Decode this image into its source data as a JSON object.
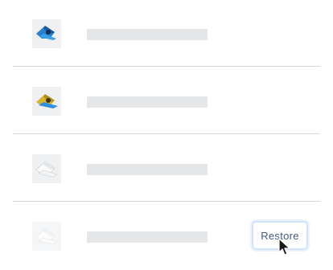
{
  "list": {
    "items": [
      {
        "thumbnail": "blue-3d-part-thumbnail",
        "faded": false
      },
      {
        "thumbnail": "yellow-blue-3d-part-thumbnail",
        "faded": false
      },
      {
        "thumbnail": "white-3d-part-thumbnail",
        "faded": false
      },
      {
        "thumbnail": "faded-3d-part-thumbnail",
        "faded": true
      }
    ],
    "restore_label": "Restore"
  },
  "colors": {
    "divider": "#d9d9d9",
    "placeholder": "#e5e6e8",
    "button_border": "#cfe3fa",
    "button_text": "#3d5a80"
  },
  "icons": {
    "cursor": "mouse-pointer-icon"
  }
}
